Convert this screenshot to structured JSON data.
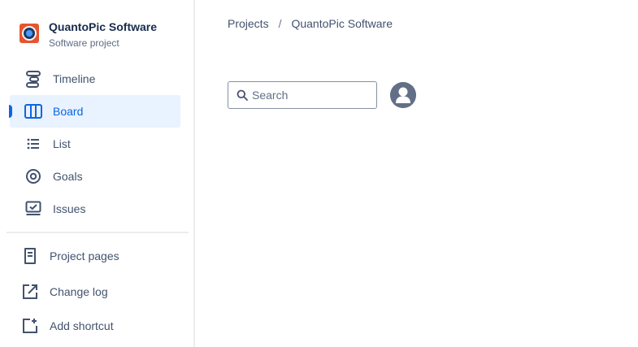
{
  "project": {
    "name": "QuantoPic Software",
    "type": "Software project"
  },
  "sidebar": {
    "items": [
      {
        "label": "Timeline",
        "icon": "timeline-icon",
        "active": false
      },
      {
        "label": "Board",
        "icon": "board-icon",
        "active": true
      },
      {
        "label": "List",
        "icon": "list-icon",
        "active": false
      },
      {
        "label": "Goals",
        "icon": "goals-icon",
        "active": false
      },
      {
        "label": "Issues",
        "icon": "issues-icon",
        "active": false
      }
    ],
    "secondary": [
      {
        "label": "Project pages",
        "icon": "page-icon"
      },
      {
        "label": "Change log",
        "icon": "external-link-icon"
      },
      {
        "label": "Add shortcut",
        "icon": "add-shortcut-icon"
      }
    ]
  },
  "breadcrumb": {
    "items": [
      "Projects",
      "QuantoPic Software"
    ],
    "separator": "/"
  },
  "search": {
    "placeholder": "Search",
    "value": ""
  },
  "colors": {
    "accent": "#0c66e4",
    "active_bg": "#e9f2ff",
    "text": "#42526e",
    "avatar": "#e8542e"
  }
}
